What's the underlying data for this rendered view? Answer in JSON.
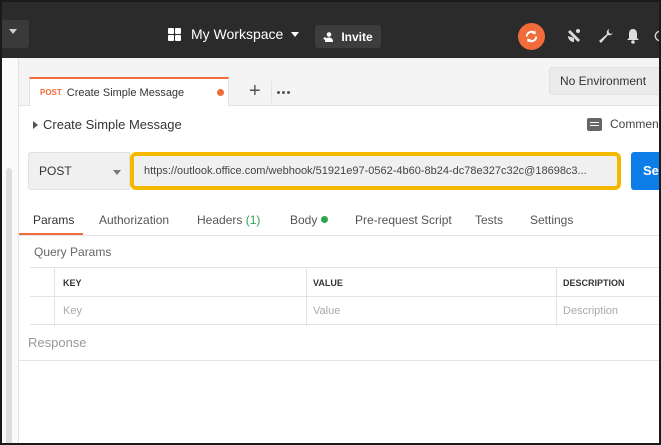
{
  "topbar": {
    "workspace_label": "My Workspace",
    "invite_label": "Invite",
    "icons": [
      "grid-icon",
      "sync-icon",
      "satellite-icon",
      "wrench-icon",
      "bell-icon"
    ]
  },
  "request_tab": {
    "method": "POST",
    "name": "Create Simple Message"
  },
  "environment": {
    "selected": "No Environment"
  },
  "request": {
    "title": "Create Simple Message",
    "comments_label": "Commen",
    "method": "POST",
    "url": "https://outlook.office.com/webhook/51921e97-0562-4b60-8b24-dc78e327c32c@18698c3...",
    "send_label": "Se"
  },
  "subtabs": {
    "params": "Params",
    "authorization": "Authorization",
    "headers": "Headers",
    "headers_count": "(1)",
    "body": "Body",
    "prerequest": "Pre-request Script",
    "tests": "Tests",
    "settings": "Settings"
  },
  "query_params": {
    "title": "Query Params",
    "columns": [
      "KEY",
      "VALUE",
      "DESCRIPTION"
    ],
    "placeholders": [
      "Key",
      "Value",
      "Description"
    ]
  },
  "response": {
    "label": "Response"
  },
  "colors": {
    "accent": "#f26b3a",
    "send_blue": "#0d7de8",
    "highlight": "#f5b800",
    "topbar": "#2b2b2b"
  }
}
